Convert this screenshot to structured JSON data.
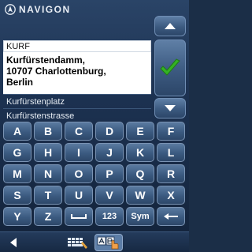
{
  "app": {
    "brand": "NAVIGON"
  },
  "search": {
    "input_value": "KURF"
  },
  "results": {
    "selected": {
      "line1": "Kurfürstendamm,",
      "line2": "10707 Charlottenburg,",
      "line3": "Berlin"
    },
    "items": [
      "Kurfürstenplatz",
      "Kurfürstenstrasse"
    ]
  },
  "keyboard": {
    "keys": [
      "A",
      "B",
      "C",
      "D",
      "E",
      "F",
      "G",
      "H",
      "I",
      "J",
      "K",
      "L",
      "M",
      "N",
      "O",
      "P",
      "Q",
      "R",
      "S",
      "T",
      "U",
      "V",
      "W",
      "X",
      "Y",
      "Z",
      "",
      "123",
      "Sym",
      ""
    ],
    "space_key": "space",
    "backspace_key": "backspace"
  },
  "icons": {
    "up": "chevron-up-icon",
    "ok": "checkmark-icon",
    "down": "chevron-down-icon",
    "back": "back-arrow-icon",
    "keyboard_mode": "keyboard-icon",
    "abc_mode": "abc-touch-icon"
  },
  "colors": {
    "accent_green": "#2ea11f",
    "background": "#1c3150",
    "key": "#3b5a80"
  }
}
